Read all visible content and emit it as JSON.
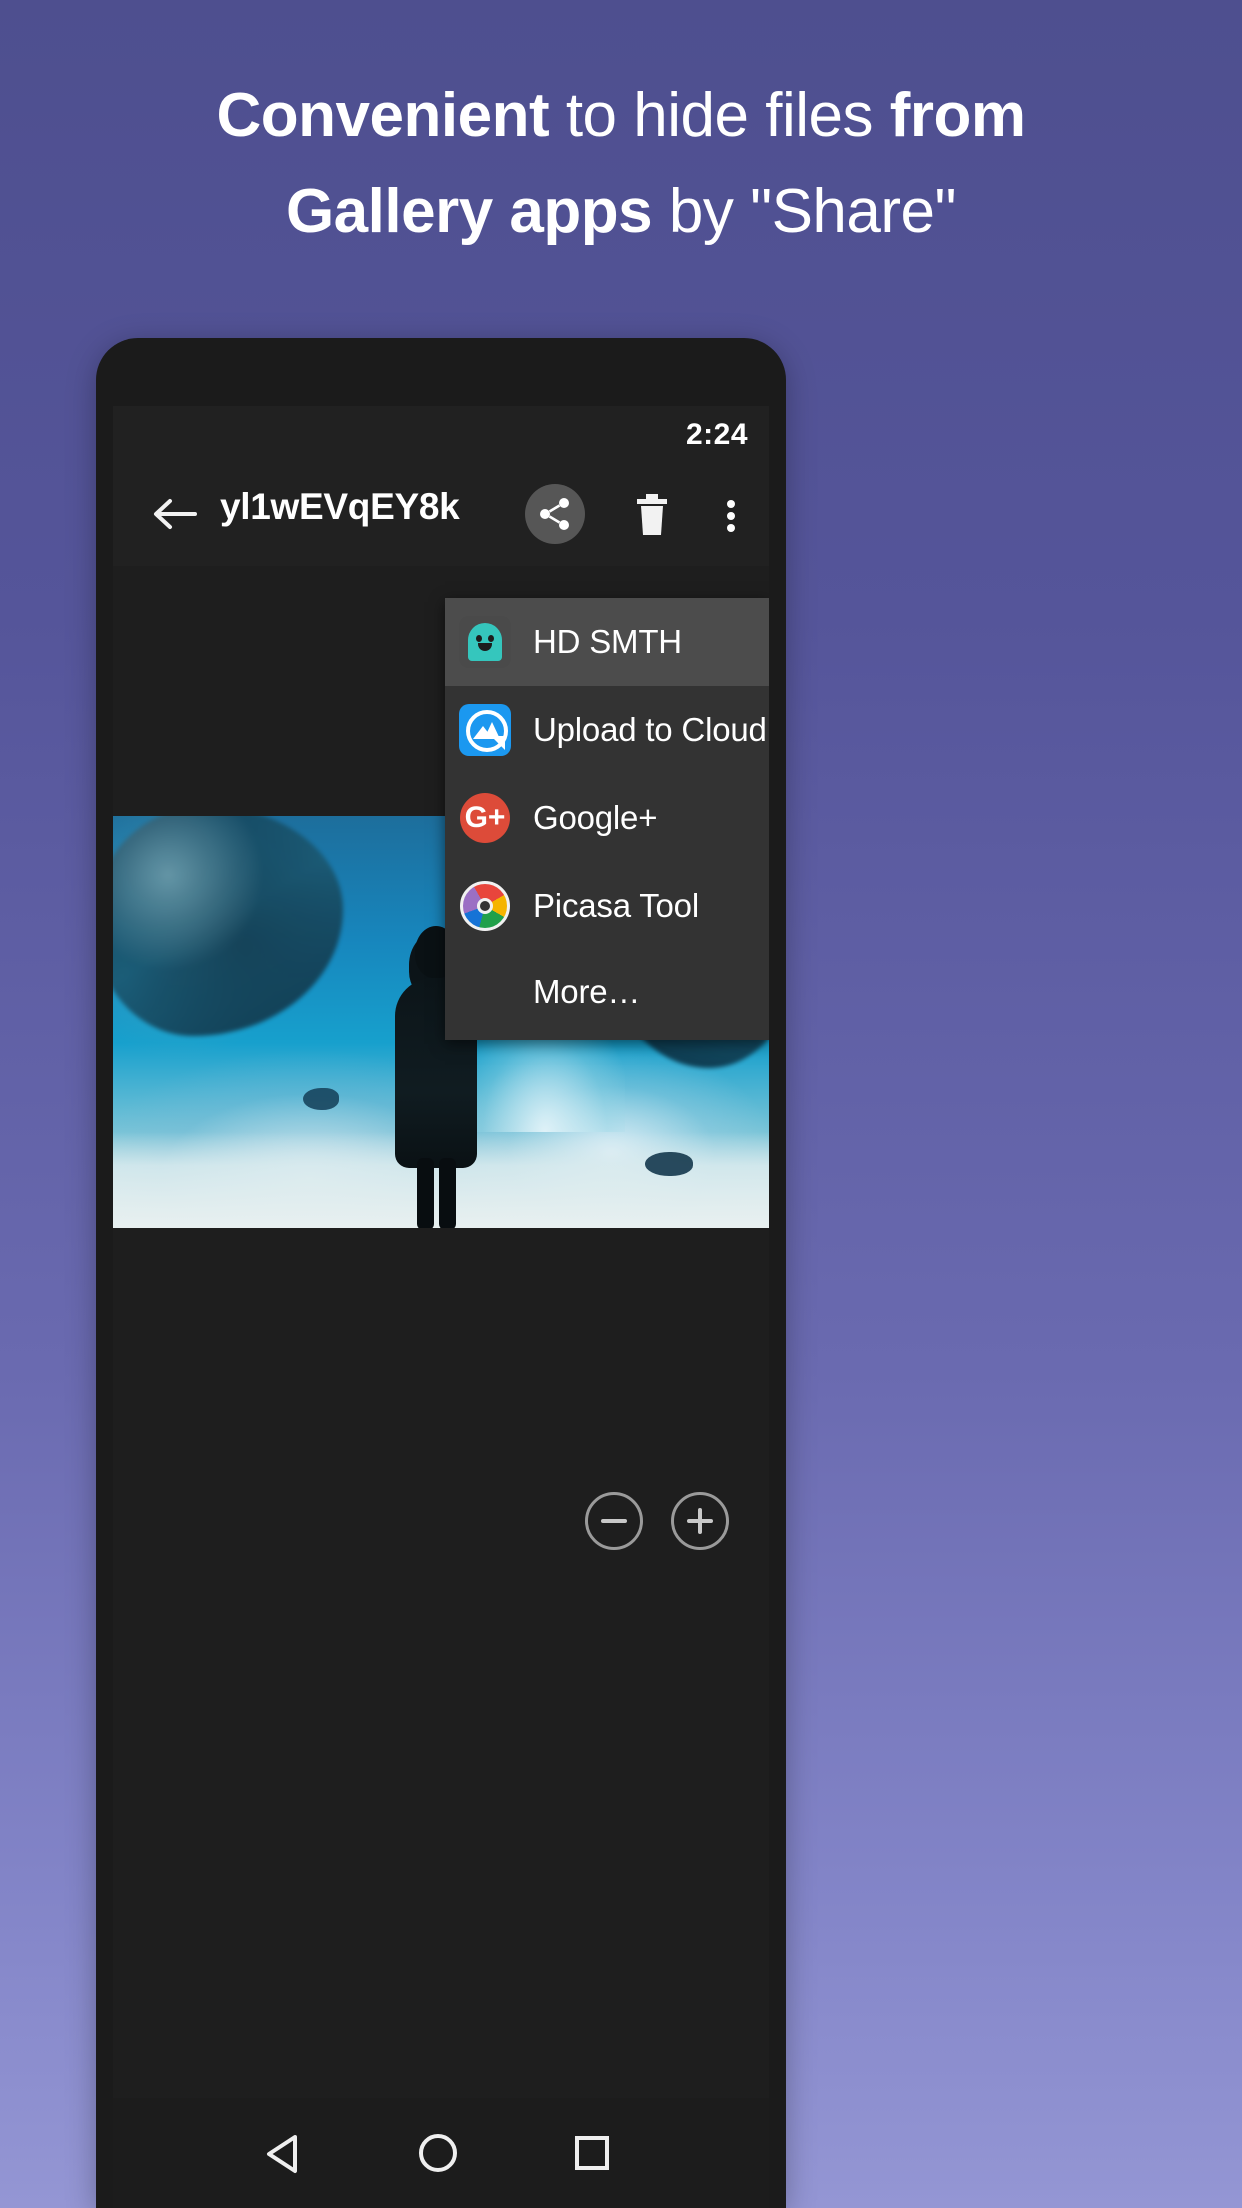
{
  "headline": {
    "line1_bold_a": "Convenient",
    "line1_regular": " to hide files ",
    "line1_bold_b": "from",
    "line2_bold": "Gallery apps",
    "line2_regular": " by \"Share\""
  },
  "colors": {
    "background_top": "#4e4f8f",
    "background_bottom": "#9496d4",
    "phone_body": "#1b1b1b",
    "toolbar": "#212121",
    "menu_background": "#333333",
    "menu_selected": "#4c4c4c",
    "accent_ghost": "#35c6bd",
    "accent_cloud": "#1b98f0",
    "accent_gplus": "#dd4b39"
  },
  "statusbar": {
    "time": "2:24"
  },
  "toolbar": {
    "back_label": "back-arrow",
    "title": "yl1wEVqEY8k",
    "share_label": "Share",
    "delete_label": "Delete",
    "overflow_label": "More options"
  },
  "share_menu": {
    "items": [
      {
        "label": "HD SMTH",
        "icon": "ghost-icon",
        "selected": true
      },
      {
        "label": "Upload to Cloud",
        "icon": "cloud-icon",
        "selected": false
      },
      {
        "label": "Google+",
        "icon": "gplus-icon",
        "selected": false
      },
      {
        "label": "Picasa Tool",
        "icon": "picasa-icon",
        "selected": false
      }
    ],
    "more_label": "More…",
    "gplus_glyph": "G+"
  },
  "zoom_controls": {
    "zoom_out_label": "Zoom out",
    "zoom_in_label": "Zoom in"
  },
  "navbar": {
    "back_label": "Back",
    "home_label": "Home",
    "recents_label": "Recent apps"
  }
}
